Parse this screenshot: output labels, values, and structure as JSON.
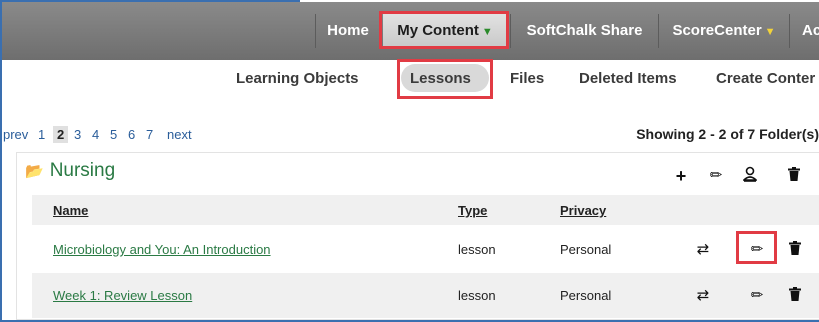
{
  "nav": {
    "items": [
      {
        "label": "Home"
      },
      {
        "label": "My Content",
        "caret": "▼"
      },
      {
        "label": "SoftChalk Share"
      },
      {
        "label": "ScoreCenter",
        "caret": "▼"
      },
      {
        "label": "Ac"
      }
    ]
  },
  "subnav": {
    "items": [
      {
        "label": "Learning Objects"
      },
      {
        "label": "Lessons"
      },
      {
        "label": "Files"
      },
      {
        "label": "Deleted Items"
      },
      {
        "label": "Create Conter"
      }
    ]
  },
  "pagination": {
    "prev": "prev",
    "pages": [
      "1",
      "2",
      "3",
      "4",
      "5",
      "6",
      "7"
    ],
    "current": "2",
    "next": "next",
    "showing": "Showing 2 - 2 of 7 Folder(s)"
  },
  "folder": {
    "name": "Nursing",
    "icons": [
      "folder-open-icon",
      "plus-icon",
      "pencil-icon",
      "user-icon",
      "trash-icon"
    ],
    "columns": {
      "name": "Name",
      "type": "Type",
      "privacy": "Privacy"
    },
    "rows": [
      {
        "name": "Microbiology and You: An Introduction",
        "type": "lesson",
        "privacy": "Personal"
      },
      {
        "name": "Week 1: Review Lesson",
        "type": "lesson",
        "privacy": "Personal"
      }
    ]
  },
  "colors": {
    "highlight": "#e13b44",
    "link": "#2a7a44",
    "topbar": "#7a7a7a",
    "frame": "#3a6fb0"
  }
}
